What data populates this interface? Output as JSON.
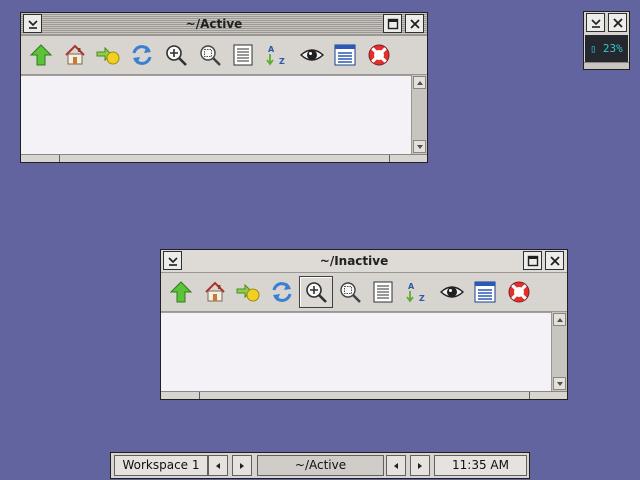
{
  "windows": {
    "active": {
      "title": "~/Active",
      "state": "focused"
    },
    "inactive": {
      "title": "~/Inactive",
      "state": "unfocused"
    }
  },
  "toolbar_icons": [
    "up-arrow-icon",
    "home-icon",
    "go-to-icon",
    "reload-icon",
    "zoom-in-icon",
    "zoom-out-icon",
    "details-view-icon",
    "sort-icon",
    "show-hidden-icon",
    "list-view-icon",
    "help-icon"
  ],
  "mini_window": {
    "battery_text": "23%"
  },
  "taskbar": {
    "workspace_label": "Workspace 1",
    "task_label": "~/Active",
    "clock": "11:35 AM"
  },
  "colors": {
    "desktop": "#61649e",
    "frame": "#d8d4d0",
    "content": "#f4f2f6",
    "meter_text": "#35c9c9"
  }
}
